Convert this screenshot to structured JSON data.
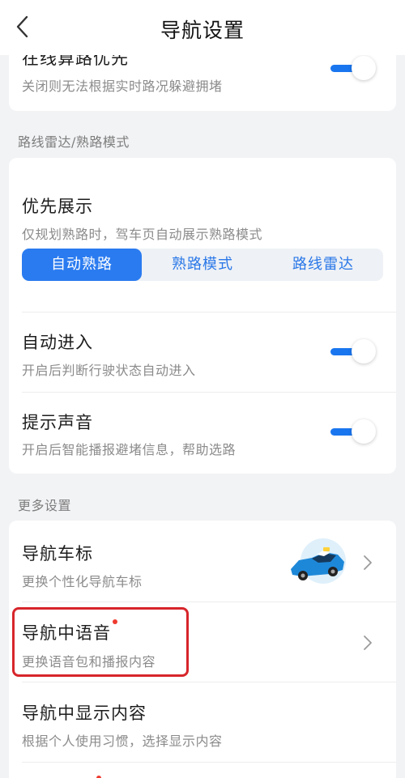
{
  "header": {
    "title": "导航设置"
  },
  "top_card": {
    "title": "在线算路优先",
    "subtitle": "关闭则无法根据实时路况躲避拥堵",
    "toggle_on": true
  },
  "section1": {
    "label": "路线雷达/熟路模式"
  },
  "radar_card": {
    "priority": {
      "title": "优先展示",
      "subtitle": "仅规划熟路时，驾车页自动展示熟路模式",
      "options": [
        "自动熟路",
        "熟路模式",
        "路线雷达"
      ],
      "selected": "自动熟路"
    },
    "auto_enter": {
      "title": "自动进入",
      "subtitle": "开启后判断行驶状态自动进入",
      "toggle_on": true
    },
    "sound": {
      "title": "提示声音",
      "subtitle": "开启后智能播报避堵信息，帮助选路",
      "toggle_on": true
    }
  },
  "section2": {
    "label": "更多设置"
  },
  "more_card": {
    "car_icon": {
      "title": "导航车标",
      "subtitle": "更换个性化导航车标"
    },
    "voice": {
      "title": "导航中语音",
      "subtitle": "更换语音包和播报内容"
    },
    "display": {
      "title": "导航中显示内容",
      "subtitle": "根据个人使用习惯，选择显示内容"
    }
  },
  "colors": {
    "accent": "#2a7bf0",
    "toggle_track": "#1a76ef",
    "highlight_border": "#d7262b",
    "badge": "#ef3a2f",
    "background": "#f2f3f5"
  }
}
